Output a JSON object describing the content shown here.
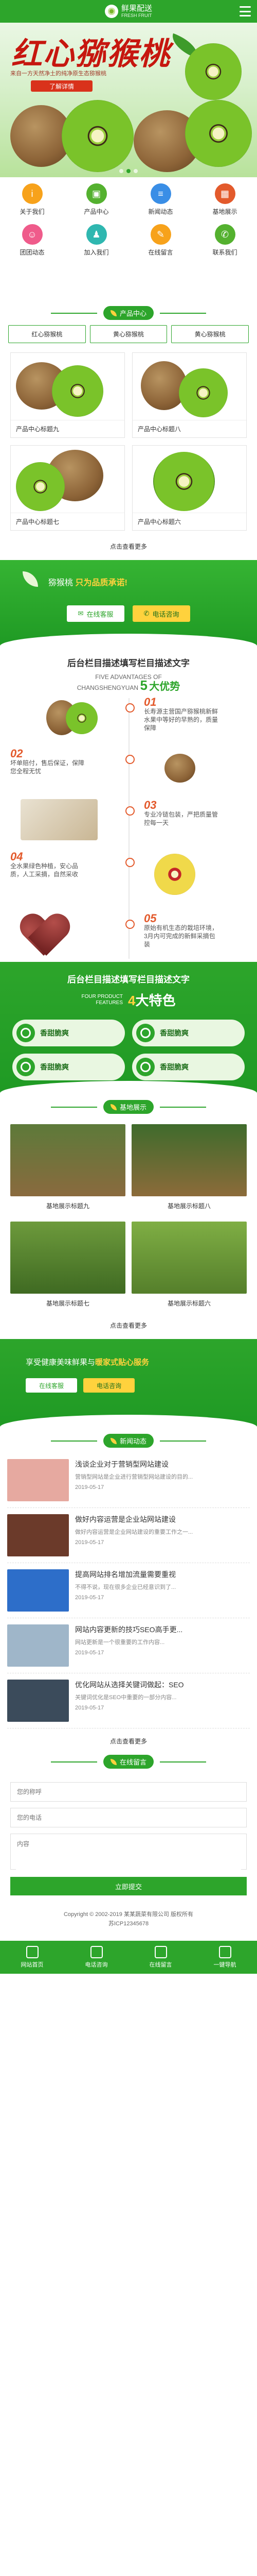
{
  "header": {
    "title": "鲜果配送",
    "subtitle": "FRESH FRUIT",
    "menu_icon": "menu-icon"
  },
  "banner": {
    "headline": "红心猕猴桃",
    "slogan": "来自一方天然净土的纯净原生态猕猴桃",
    "button": "了解详情",
    "dots": 3,
    "active_dot": 2
  },
  "nav": [
    {
      "label": "关于我们",
      "icon": "info-icon",
      "color": "#f7a21b"
    },
    {
      "label": "产品中心",
      "icon": "box-icon",
      "color": "#54b12f"
    },
    {
      "label": "新闻动态",
      "icon": "news-icon",
      "color": "#3a8ee6"
    },
    {
      "label": "基地展示",
      "icon": "image-icon",
      "color": "#e35a2c"
    },
    {
      "label": "团团动态",
      "icon": "group-icon",
      "color": "#ef5b8b"
    },
    {
      "label": "加入我们",
      "icon": "user-icon",
      "color": "#2fb7b0"
    },
    {
      "label": "在线留言",
      "icon": "message-icon",
      "color": "#f7a21b"
    },
    {
      "label": "联系我们",
      "icon": "phone-icon",
      "color": "#54b12f"
    }
  ],
  "products_section": {
    "title": "产品中心",
    "categories": [
      "红心猕猴桃",
      "黄心猕猴桃",
      "黄心猕猴桃"
    ],
    "items": [
      {
        "label": "产品中心标题九"
      },
      {
        "label": "产品中心标题八"
      },
      {
        "label": "产品中心标题七"
      },
      {
        "label": "产品中心标题六"
      }
    ],
    "more": "点击查看更多"
  },
  "promo": {
    "text_prefix": "猕猴桃   ",
    "text_highlight": "只为品质承诺!",
    "btn_call": "在线客服",
    "btn_phone": "电话咨询"
  },
  "advantages": {
    "heading": "后台栏目描述填写栏目描述文字",
    "en1": "FIVE ADVANTAGES OF",
    "en2": "CHANGSHENGYUAN",
    "count": "5",
    "tail": "大优势",
    "items": [
      {
        "num": "01",
        "text": "长寿源主营国产猕猴桃新鲜水果中等好的早熟的，质量保障"
      },
      {
        "num": "02",
        "text": "坏单赔付，售后保证，保障您全程无忧"
      },
      {
        "num": "03",
        "text": "专业冷链包装，严把质量管控每一天"
      },
      {
        "num": "04",
        "text": "全水果绿色种植，安心品质，人工采摘，自然采收"
      },
      {
        "num": "05",
        "text": "原始有机生态的栽培环境，3月内可完成的新鲜采摘包装"
      }
    ]
  },
  "features": {
    "heading": "后台栏目描述填写栏目描述文字",
    "en1": "FOUR PRODUCT",
    "en2": "FEATURES",
    "count": "4",
    "tail": "大特色",
    "items": [
      "香甜脆爽",
      "香甜脆爽",
      "香甜脆爽",
      "香甜脆爽"
    ]
  },
  "bases": {
    "title": "基地展示",
    "items": [
      {
        "label": "基地展示标题九"
      },
      {
        "label": "基地展示标题八"
      },
      {
        "label": "基地展示标题七"
      },
      {
        "label": "基地展示标题六"
      }
    ],
    "more": "点击查看更多"
  },
  "service": {
    "text_prefix": "享受健康美味鲜果与",
    "text_highlight": "暖家式贴心服务",
    "btn_call": "在线客服",
    "btn_phone": "电话咨询"
  },
  "news": {
    "title": "新闻动态",
    "items": [
      {
        "title": "浅谈企业对于营销型网站建设",
        "desc": "营销型网站是企业进行营销型网站建设的目的...",
        "date": "2019-05-17",
        "thumb": "#e6a9a0"
      },
      {
        "title": "做好内容运营是企业站网站建设",
        "desc": "做好内容运营是企业网站建设的重要工作之一...",
        "date": "2019-05-17",
        "thumb": "#6b3a2a"
      },
      {
        "title": "提高网站排名增加流量需要重视",
        "desc": "不得不说，现在很多企业已经意识到了...",
        "date": "2019-05-17",
        "thumb": "#2d6ec9"
      },
      {
        "title": "网站内容更新的技巧SEO高手更...",
        "desc": "网站更新是一个很重要的工作内容...",
        "date": "2019-05-17",
        "thumb": "#9fb6c9"
      },
      {
        "title": "优化网站从选择关键词做起：SEO",
        "desc": "关键词优化是SEO中重要的一部分内容...",
        "date": "2019-05-17",
        "thumb": "#3b4b5b"
      }
    ],
    "more": "点击查看更多"
  },
  "message": {
    "title": "在线留言",
    "name_placeholder": "您的称呼",
    "phone_placeholder": "您的电话",
    "content_placeholder": "内容",
    "submit": "立即提交"
  },
  "footer": {
    "copyright": "Copyright © 2002-2019 某某蔬菜有限公司 版权所有",
    "icp": "苏ICP12345678"
  },
  "tabbar": [
    "网站首页",
    "电话咨询",
    "在线留言",
    "一键导航"
  ],
  "colors": {
    "primary": "#2da52b",
    "accent": "#ffd23d",
    "orange": "#e35a2c"
  }
}
